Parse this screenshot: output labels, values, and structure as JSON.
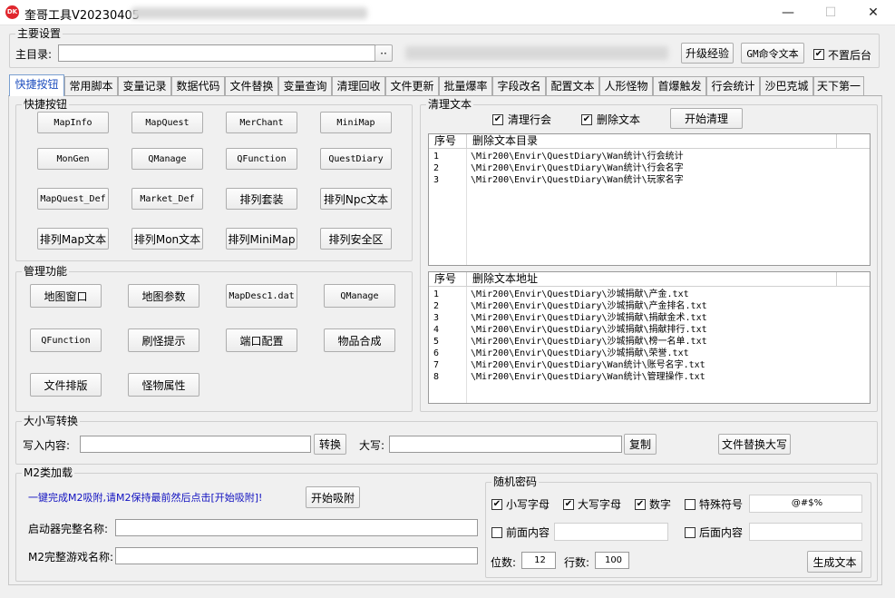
{
  "window": {
    "title": "奎哥工具V20230405",
    "minimize_symbol": "—",
    "maximize_symbol": "☐",
    "close_symbol": "✕",
    "icon_text": "DK"
  },
  "main_settings": {
    "group_label": "主要设置",
    "dir_label": "主目录:",
    "dir_value": "",
    "browse_label": "··",
    "upgrade_btn": "升级经验",
    "gm_btn": "GM命令文本",
    "no_bg_label": "不置后台",
    "no_bg_checked": true
  },
  "tabs": [
    "快捷按钮",
    "常用脚本",
    "变量记录",
    "数据代码",
    "文件替换",
    "变量查询",
    "清理回收",
    "文件更新",
    "批量爆率",
    "字段改名",
    "配置文本",
    "人形怪物",
    "首爆触发",
    "行会统计",
    "沙巴克城",
    "天下第一"
  ],
  "quick_buttons": {
    "group_label": "快捷按钮",
    "buttons": [
      "MapInfo",
      "MapQuest",
      "MerChant",
      "MiniMap",
      "MonGen",
      "QManage",
      "QFunction",
      "QuestDiary",
      "MapQuest_Def",
      "Market_Def",
      "排列套装",
      "排列Npc文本",
      "排列Map文本",
      "排列Mon文本",
      "排列MiniMap",
      "排列安全区"
    ]
  },
  "manage": {
    "group_label": "管理功能",
    "buttons": [
      "地图窗口",
      "地图参数",
      "MapDesc1.dat",
      "QManage",
      "QFunction",
      "刷怪提示",
      "端口配置",
      "物品合成",
      "文件排版",
      "怪物属性"
    ]
  },
  "clean_text": {
    "group_label": "清理文本",
    "clean_guild_label": "清理行会",
    "clean_guild_checked": true,
    "delete_text_label": "删除文本",
    "delete_text_checked": true,
    "start_btn": "开始清理",
    "dir_list": {
      "col_idx": "序号",
      "col_path": "删除文本目录",
      "rows": [
        {
          "idx": "1",
          "path": "\\Mir200\\Envir\\QuestDiary\\Wan统计\\行会统计"
        },
        {
          "idx": "2",
          "path": "\\Mir200\\Envir\\QuestDiary\\Wan统计\\行会名字"
        },
        {
          "idx": "3",
          "path": "\\Mir200\\Envir\\QuestDiary\\Wan统计\\玩家名字"
        }
      ]
    },
    "file_list": {
      "col_idx": "序号",
      "col_path": "删除文本地址",
      "rows": [
        {
          "idx": "1",
          "path": "\\Mir200\\Envir\\QuestDiary\\沙城捐献\\产金.txt"
        },
        {
          "idx": "2",
          "path": "\\Mir200\\Envir\\QuestDiary\\沙城捐献\\产金排名.txt"
        },
        {
          "idx": "3",
          "path": "\\Mir200\\Envir\\QuestDiary\\沙城捐献\\捐献金术.txt"
        },
        {
          "idx": "4",
          "path": "\\Mir200\\Envir\\QuestDiary\\沙城捐献\\捐献排行.txt"
        },
        {
          "idx": "5",
          "path": "\\Mir200\\Envir\\QuestDiary\\沙城捐献\\榜一名单.txt"
        },
        {
          "idx": "6",
          "path": "\\Mir200\\Envir\\QuestDiary\\沙城捐献\\荣誉.txt"
        },
        {
          "idx": "7",
          "path": "\\Mir200\\Envir\\QuestDiary\\Wan统计\\账号名字.txt"
        },
        {
          "idx": "8",
          "path": "\\Mir200\\Envir\\QuestDiary\\Wan统计\\管理操作.txt"
        }
      ]
    }
  },
  "case_convert": {
    "group_label": "大小写转换",
    "input_label": "写入内容:",
    "input_value": "",
    "convert_btn": "转换",
    "upper_label": "大写:",
    "upper_value": "",
    "copy_btn": "复制",
    "file_replace_btn": "文件替换大写"
  },
  "m2_load": {
    "group_label": "M2类加载",
    "hint": "一键完成M2吸附,请M2保持最前然后点击[开始吸附]!",
    "start_btn": "开始吸附",
    "launcher_label": "启动器完整名称:",
    "launcher_value": "",
    "game_label": "M2完整游戏名称:",
    "game_value": ""
  },
  "random_pwd": {
    "group_label": "随机密码",
    "lower_label": "小写字母",
    "lower_checked": true,
    "upper_label": "大写字母",
    "upper_checked": true,
    "digit_label": "数字",
    "digit_checked": true,
    "special_label": "特殊符号",
    "special_checked": false,
    "special_value": "@#$%",
    "prefix_label": "前面内容",
    "prefix_checked": false,
    "prefix_value": "",
    "suffix_label": "后面内容",
    "suffix_checked": false,
    "suffix_value": "",
    "digits_label": "位数:",
    "digits_value": "12",
    "rows_label": "行数:",
    "rows_value": "100",
    "generate_btn": "生成文本"
  }
}
